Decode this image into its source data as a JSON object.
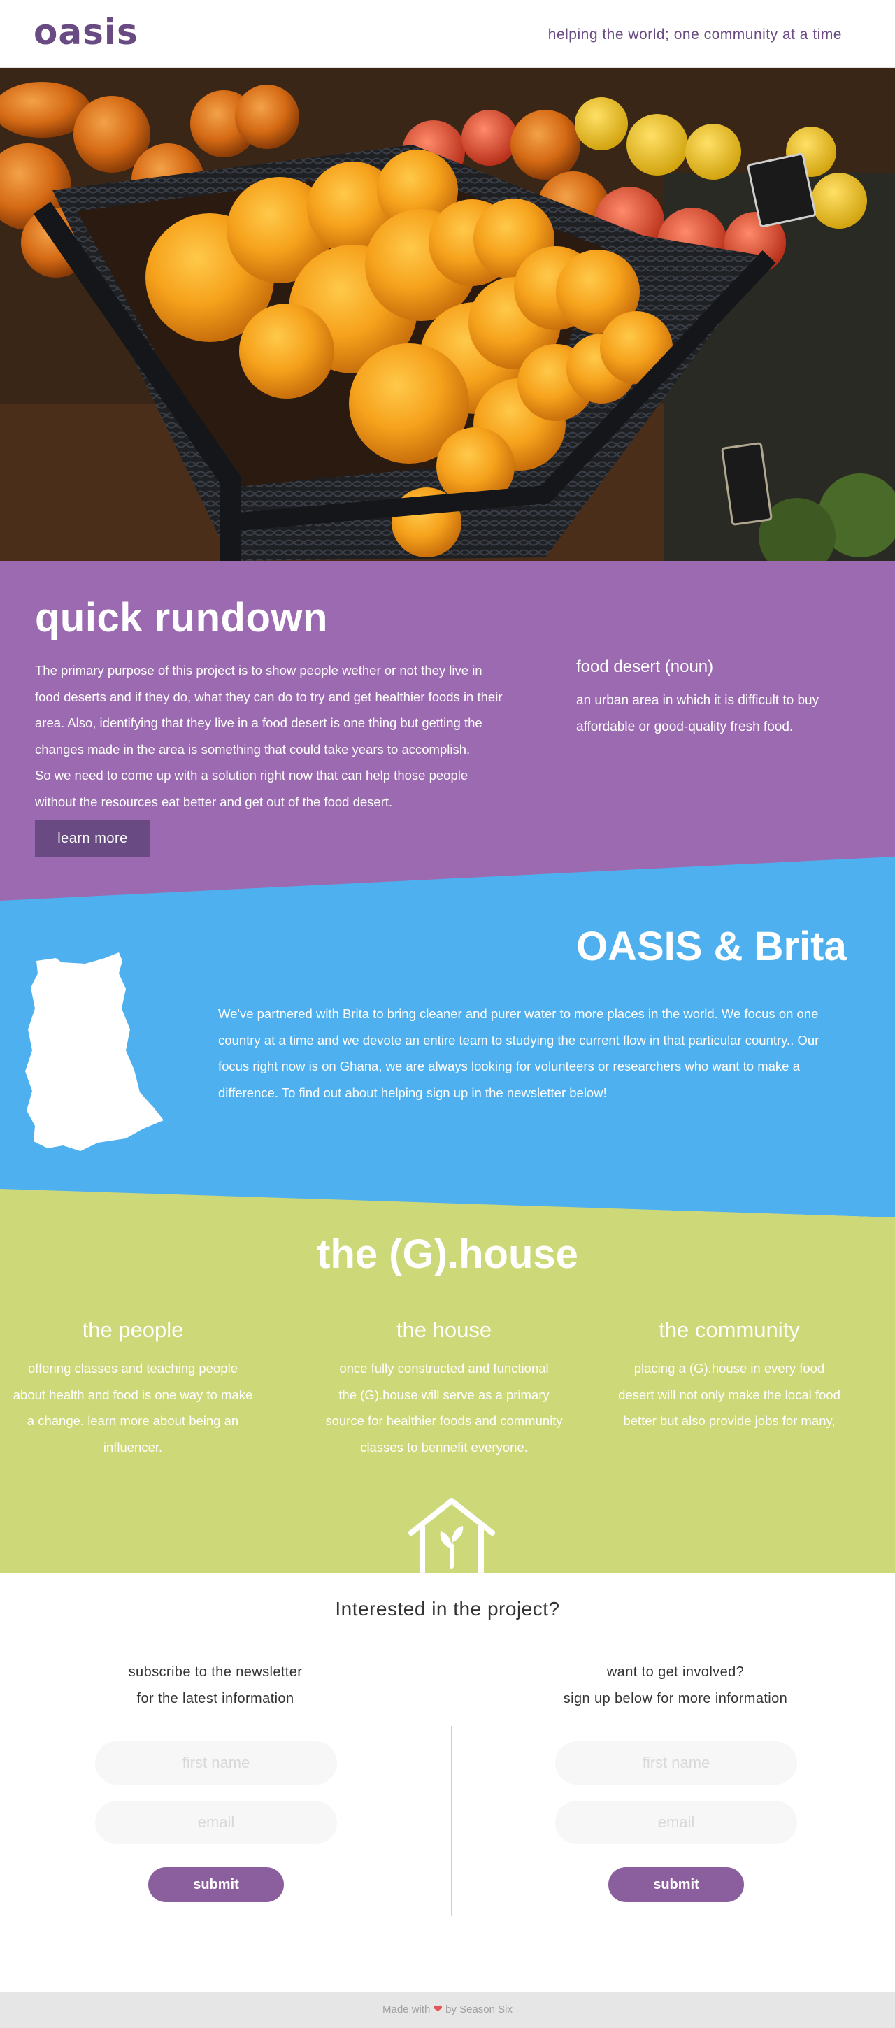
{
  "header": {
    "logo": "oasis",
    "tagline": "helping the world; one community at a time"
  },
  "hero": {
    "image_description": "baskets of oranges and produce"
  },
  "rundown": {
    "title": "quick rundown",
    "body_lines": [
      "The primary purpose of this project is to show people wether or not they live in",
      "food deserts and if they do, what they can do to try and get healthier foods in their",
      "area. Also, identifying that they live in a food desert is one thing but getting the",
      "changes made in the area is something that could take years to accomplish.",
      "So we need to come up with a solution right now that can help those people",
      "without the resources eat better and get out of the food desert."
    ],
    "button_label": "learn more",
    "definition_term": "food desert (noun)",
    "definition_lines": [
      "an urban area in which it is difficult to buy",
      "affordable or good-quality fresh food."
    ]
  },
  "brita": {
    "title": "OASIS & Brita",
    "body_lines": [
      "We've partnered with Brita to bring cleaner and purer water to more places in the world. We focus on  one",
      "country at a time and we devote an entire team to studying the current flow in that particular country.. Our",
      "focus right now is on Ghana, we are always looking for volunteers or researchers who want to make a",
      "difference. To find out about helping sign up in the newsletter below!"
    ]
  },
  "ghouse": {
    "title": "the (G).house",
    "columns": [
      {
        "title": "the people",
        "lines": [
          "offering classes and  teaching people",
          "about health and food is one way to make",
          "a change. learn more about being an",
          "influencer."
        ]
      },
      {
        "title": "the house",
        "lines": [
          "once fully constructed and functional",
          "the (G).house will serve as a primary",
          "source for healthier foods and community",
          "classes to bennefit everyone."
        ]
      },
      {
        "title": "the community",
        "lines": [
          "placing a (G).house in every food",
          "desert will not only make the local food",
          "better but also provide jobs for many,"
        ]
      }
    ]
  },
  "interest": {
    "title": "Interested in the project?",
    "newsletter": {
      "heading_lines": [
        "subscribe to the newsletter",
        "for the latest information"
      ],
      "first_name_placeholder": "first name",
      "email_placeholder": "email",
      "submit_label": "submit"
    },
    "volunteer": {
      "heading_lines": [
        "want to get involved?",
        "sign up below for more information"
      ],
      "first_name_placeholder": "first name",
      "email_placeholder": "email",
      "submit_label": "submit"
    }
  },
  "footer": {
    "made_with": "Made with",
    "by": "by Season Six"
  },
  "colors": {
    "brand_purple": "#6a4a82",
    "section_purple": "#9c6ab0",
    "section_blue": "#4fb0ef",
    "section_green": "#cdd878",
    "button_purple": "#8b5f9e",
    "heart_red": "#e2555a"
  }
}
